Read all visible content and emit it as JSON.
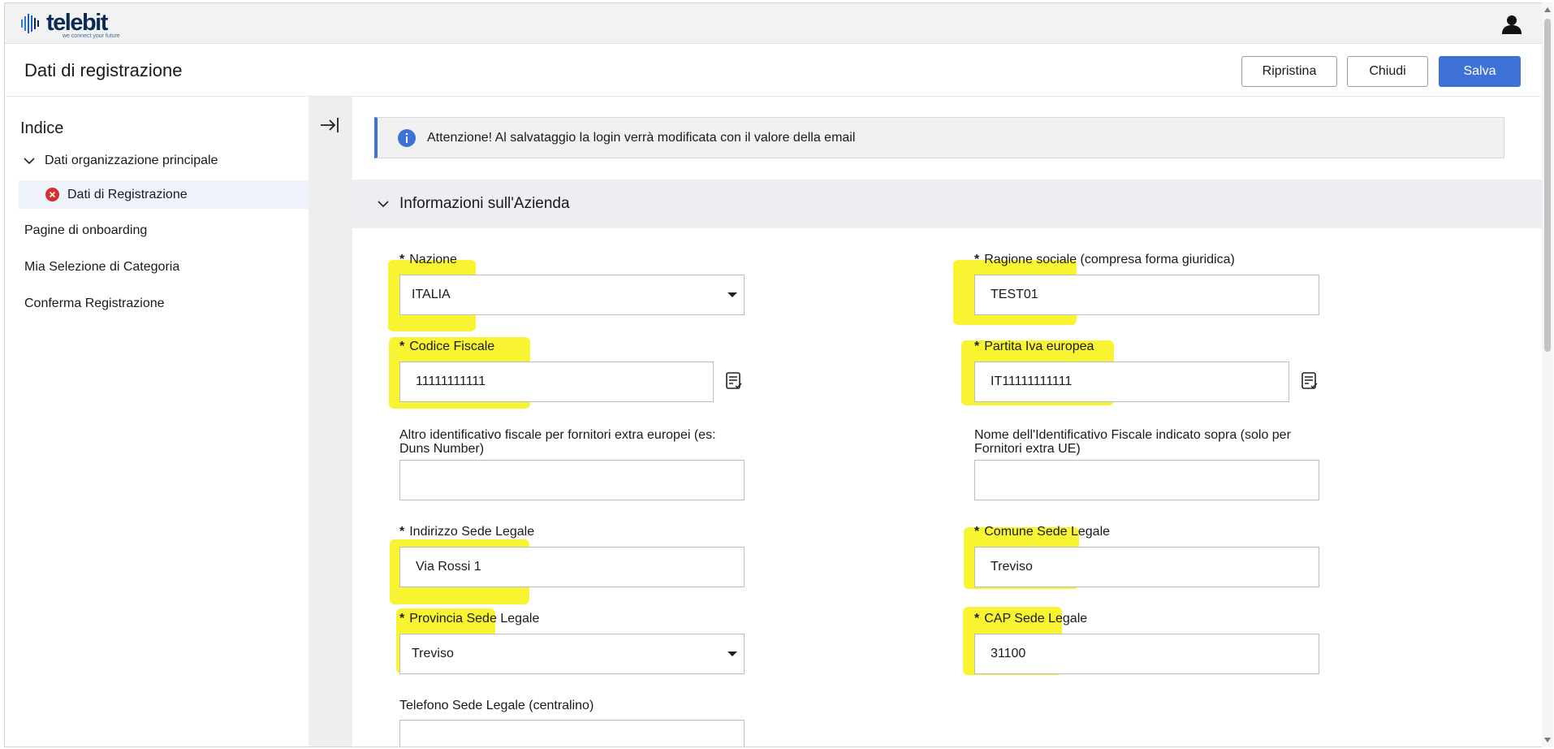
{
  "header": {
    "logo_text": "telebit",
    "logo_tagline": "we connect your future",
    "user_icon": "user-icon"
  },
  "titlebar": {
    "title": "Dati di registrazione",
    "reset_label": "Ripristina",
    "close_label": "Chiudi",
    "save_label": "Salva",
    "save_color": "#3e72d6"
  },
  "sidebar": {
    "title": "Indice",
    "group_label": "Dati organizzazione principale",
    "active_item": "Dati di Registrazione",
    "items": [
      {
        "label": "Pagine di onboarding"
      },
      {
        "label": "Mia Selezione di Categoria"
      },
      {
        "label": "Conferma Registrazione"
      }
    ]
  },
  "alert": {
    "text": "Attenzione! Al salvataggio la login verrà modificata con il valore della email",
    "accent": "#3e72d6"
  },
  "section": {
    "title": "Informazioni sull'Azienda"
  },
  "fields": {
    "nazione": {
      "label": "Nazione",
      "value": "ITALIA",
      "required": "*"
    },
    "ragione_sociale": {
      "label": "Ragione sociale (compresa forma giuridica)",
      "value": "TEST01",
      "required": "*"
    },
    "codice_fiscale": {
      "label": "Codice Fiscale",
      "value": "11111111111",
      "required": "*"
    },
    "partita_iva": {
      "label": "Partita Iva europea",
      "value": "IT11111111111",
      "required": "*"
    },
    "altro_id": {
      "label": "Altro identificativo fiscale per fornitori extra europei (es: Duns Number)",
      "value": ""
    },
    "nome_id": {
      "label": "Nome dell'Identificativo Fiscale indicato sopra (solo per Fornitori extra UE)",
      "value": ""
    },
    "indirizzo": {
      "label": "Indirizzo Sede Legale",
      "value": "Via Rossi 1",
      "required": "*"
    },
    "comune": {
      "label": "Comune Sede Legale",
      "value": "Treviso",
      "required": "*"
    },
    "provincia": {
      "label": "Provincia Sede Legale",
      "value": "Treviso",
      "required": "*"
    },
    "cap": {
      "label": "CAP Sede Legale",
      "value": "31100",
      "required": "*"
    },
    "telefono": {
      "label": "Telefono Sede Legale (centralino)",
      "value": ""
    }
  },
  "highlight_color": "#f7f20e"
}
